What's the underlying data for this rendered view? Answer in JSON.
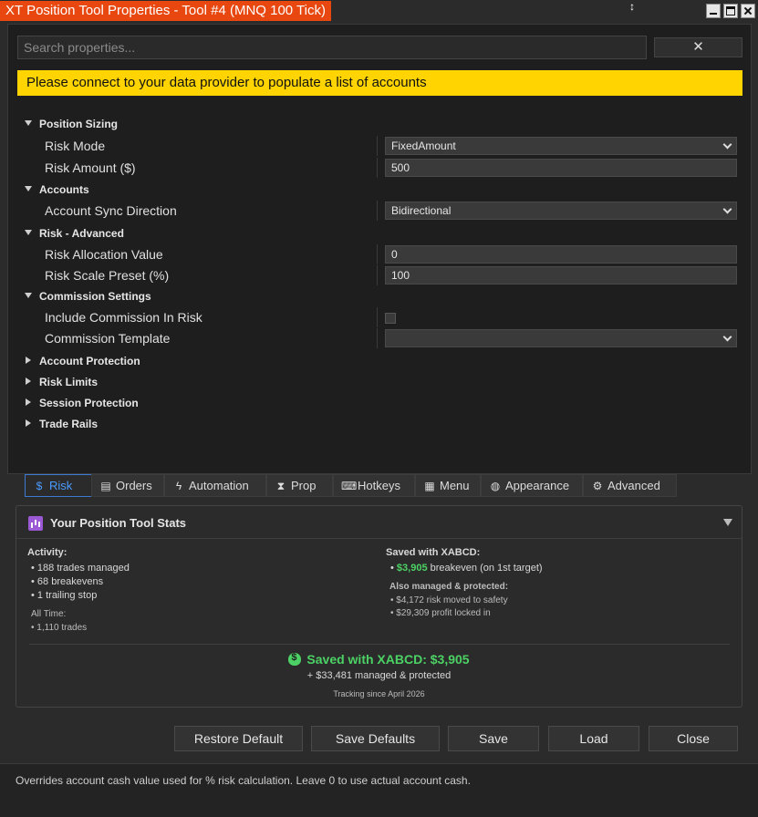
{
  "window": {
    "title": "XT Position Tool Properties - Tool #4 (MNQ 100 Tick)"
  },
  "search": {
    "placeholder": "Search properties...",
    "clear_label": "✕"
  },
  "banner": "Please connect to your data provider to populate a list of accounts",
  "properties": {
    "position_sizing": {
      "label": "Position Sizing",
      "risk_mode": {
        "label": "Risk Mode",
        "value": "FixedAmount"
      },
      "risk_amount": {
        "label": "Risk Amount ($)",
        "value": "500"
      }
    },
    "accounts": {
      "label": "Accounts",
      "sync_direction": {
        "label": "Account Sync Direction",
        "value": "Bidirectional"
      }
    },
    "risk_advanced": {
      "label": "Risk - Advanced",
      "allocation_value": {
        "label": "Risk Allocation Value",
        "value": "0"
      },
      "scale_preset": {
        "label": "Risk Scale Preset (%)",
        "value": "100"
      }
    },
    "commission": {
      "label": "Commission Settings",
      "include_in_risk": {
        "label": "Include Commission In Risk",
        "checked": false
      },
      "template": {
        "label": "Commission Template",
        "value": ""
      }
    },
    "collapsed": [
      "Account Protection",
      "Risk Limits",
      "Session Protection",
      "Trade Rails"
    ]
  },
  "tabs": [
    {
      "label": "Risk",
      "icon": "money-bag-icon",
      "active": true
    },
    {
      "label": "Orders",
      "icon": "orders-icon",
      "active": false
    },
    {
      "label": "Automation",
      "icon": "lightning-icon",
      "active": false
    },
    {
      "label": "Prop",
      "icon": "hourglass-icon",
      "active": false
    },
    {
      "label": "Hotkeys",
      "icon": "keyboard-icon",
      "active": false
    },
    {
      "label": "Menu",
      "icon": "menu-icon",
      "active": false
    },
    {
      "label": "Appearance",
      "icon": "palette-icon",
      "active": false
    },
    {
      "label": "Advanced",
      "icon": "gear-icon",
      "active": false
    }
  ],
  "stats": {
    "title": "Your Position Tool Stats",
    "activity_label": "Activity:",
    "activity": [
      "188 trades managed",
      "68 breakevens",
      "1 trailing stop"
    ],
    "alltime_label": "All Time:",
    "alltime": [
      "1,110 trades"
    ],
    "saved_label": "Saved with XABCD:",
    "saved_amount": "$3,905",
    "saved_detail": "breakeven (on 1st target)",
    "also_label": "Also managed & protected:",
    "also": [
      "$4,172 risk moved to safety",
      "$29,309 profit locked in"
    ],
    "summary_title": "Saved with XABCD: $3,905",
    "summary_sub": "+ $33,481 managed & protected",
    "tracking": "Tracking since April 2026",
    "accent_color": "#4cd264"
  },
  "buttons": {
    "restore_default": "Restore Default",
    "save_defaults": "Save Defaults",
    "save": "Save",
    "load": "Load",
    "close": "Close"
  },
  "footer": "Overrides account cash value used for % risk calculation. Leave 0 to use actual account cash."
}
